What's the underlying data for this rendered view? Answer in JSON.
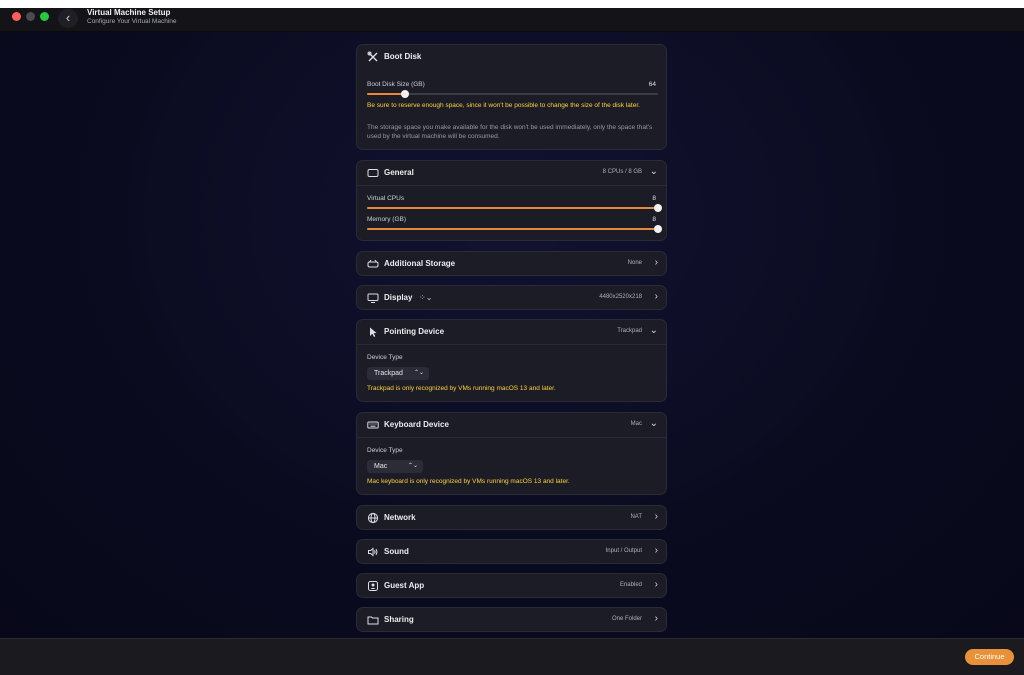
{
  "window": {
    "title": "Virtual Machine Setup",
    "subtitle": "Configure Your Virtual Machine"
  },
  "boot_disk": {
    "title": "Boot Disk",
    "icon": "tools-icon",
    "size_label": "Boot Disk Size (GB)",
    "size_value": "64",
    "slider_fraction": 0.13,
    "warning": "Be sure to reserve enough space, since it won't be possible to change the size of the disk later.",
    "note": "The storage space you make available for the disk won't be used immediately, only the space that's used by the virtual machine will be consumed."
  },
  "general": {
    "title": "General",
    "summary": "8 CPUs / 8 GB",
    "cpu_label": "Virtual CPUs",
    "cpu_value": "8",
    "cpu_fraction": 1.0,
    "memory_label": "Memory (GB)",
    "memory_value": "8",
    "memory_fraction": 1.0
  },
  "additional_storage": {
    "title": "Additional Storage",
    "summary": "None"
  },
  "display": {
    "title": "Display",
    "summary": "4480x2520x218"
  },
  "pointing": {
    "title": "Pointing Device",
    "summary": "Trackpad",
    "type_label": "Device Type",
    "selected": "Trackpad",
    "warning": "Trackpad is only recognized by VMs running macOS 13 and later."
  },
  "keyboard": {
    "title": "Keyboard Device",
    "summary": "Mac",
    "type_label": "Device Type",
    "selected": "Mac",
    "warning": "Mac keyboard is only recognized by VMs running macOS 13 and later."
  },
  "network": {
    "title": "Network",
    "summary": "NAT"
  },
  "sound": {
    "title": "Sound",
    "summary": "Input / Output"
  },
  "guest_app": {
    "title": "Guest App",
    "summary": "Enabled"
  },
  "sharing": {
    "title": "Sharing",
    "summary": "One Folder"
  },
  "footer": {
    "continue_label": "Continue"
  },
  "colors": {
    "accent": "#e8883a",
    "warning": "#ffd23a",
    "card": "#1c1c26"
  }
}
